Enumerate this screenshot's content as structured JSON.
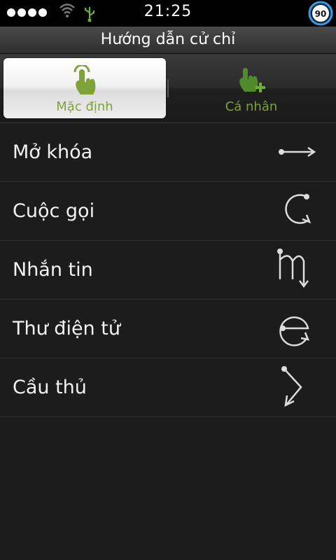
{
  "status_bar": {
    "time": "21:25",
    "battery_level": "90",
    "icons": [
      "signal-dots-icon",
      "wifi-icon",
      "usb-icon",
      "battery-icon"
    ]
  },
  "header": {
    "title": "Hướng dẫn cử chỉ"
  },
  "tabs": [
    {
      "label": "Mặc định",
      "icon": "touch-hand-icon",
      "selected": true
    },
    {
      "label": "Cá nhân",
      "icon": "hand-add-icon",
      "selected": false
    }
  ],
  "gestures": [
    {
      "label": "Mở khóa",
      "gesture_icon": "arrow-right-gesture-icon"
    },
    {
      "label": "Cuộc gọi",
      "gesture_icon": "c-gesture-icon"
    },
    {
      "label": "Nhắn tin",
      "gesture_icon": "m-gesture-icon"
    },
    {
      "label": "Thư điện tử",
      "gesture_icon": "e-gesture-icon"
    },
    {
      "label": "Cầu thủ",
      "gesture_icon": "chevron-gesture-icon"
    }
  ],
  "colors": {
    "accent": "#7ea33a",
    "background": "#1c1c1c",
    "status_bar": "#000000"
  }
}
